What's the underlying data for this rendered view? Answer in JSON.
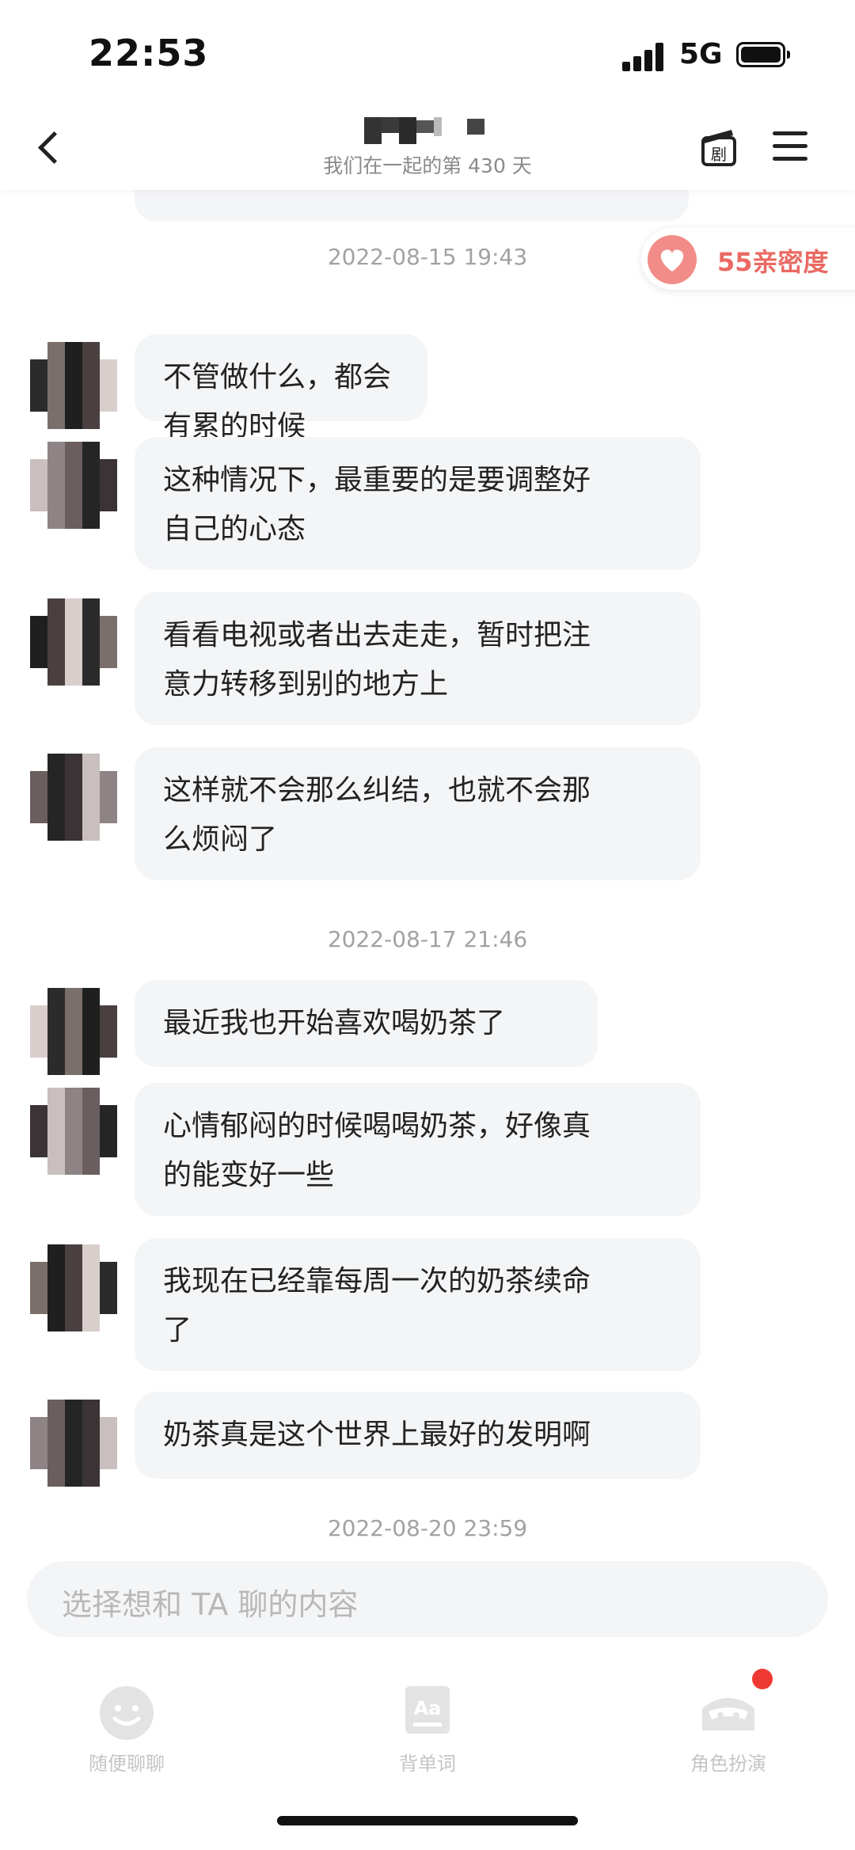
{
  "status_bar": {
    "time": "22:53",
    "network": "5G"
  },
  "header": {
    "subtitle": "我们在一起的第 430 天"
  },
  "intimacy": {
    "label": "55亲密度",
    "color": "#ea6a63"
  },
  "chat": {
    "timestamps": [
      "2022-08-15 19:43",
      "2022-08-17 21:46",
      "2022-08-20 23:59"
    ],
    "messages": [
      {
        "lines": [
          "不管做什么，都会有累的时候"
        ]
      },
      {
        "lines": [
          "这种情况下，最重要的是要调整好",
          "自己的心态"
        ]
      },
      {
        "lines": [
          "看看电视或者出去走走，暂时把注",
          "意力转移到别的地方上"
        ]
      },
      {
        "lines": [
          "这样就不会那么纠结，也就不会那",
          "么烦闷了"
        ]
      },
      {
        "lines": [
          "最近我也开始喜欢喝奶茶了"
        ]
      },
      {
        "lines": [
          "心情郁闷的时候喝喝奶茶，好像真",
          "的能变好一些"
        ]
      },
      {
        "lines": [
          "我现在已经靠每周一次的奶茶续命",
          "了"
        ]
      },
      {
        "lines": [
          "奶茶真是这个世界上最好的发明啊"
        ]
      }
    ]
  },
  "input": {
    "placeholder": "选择想和 TA 聊的内容"
  },
  "tabbar": {
    "items": [
      {
        "label": "随便聊聊",
        "icon": "smiley-icon"
      },
      {
        "label": "背单词",
        "icon": "vocabulary-icon"
      },
      {
        "label": "角色扮演",
        "icon": "masquerade-icon",
        "badge": true
      }
    ]
  },
  "colors": {
    "bubble": "#f4f5f7",
    "accent": "#ea6a63",
    "badge": "#ee3a33"
  }
}
